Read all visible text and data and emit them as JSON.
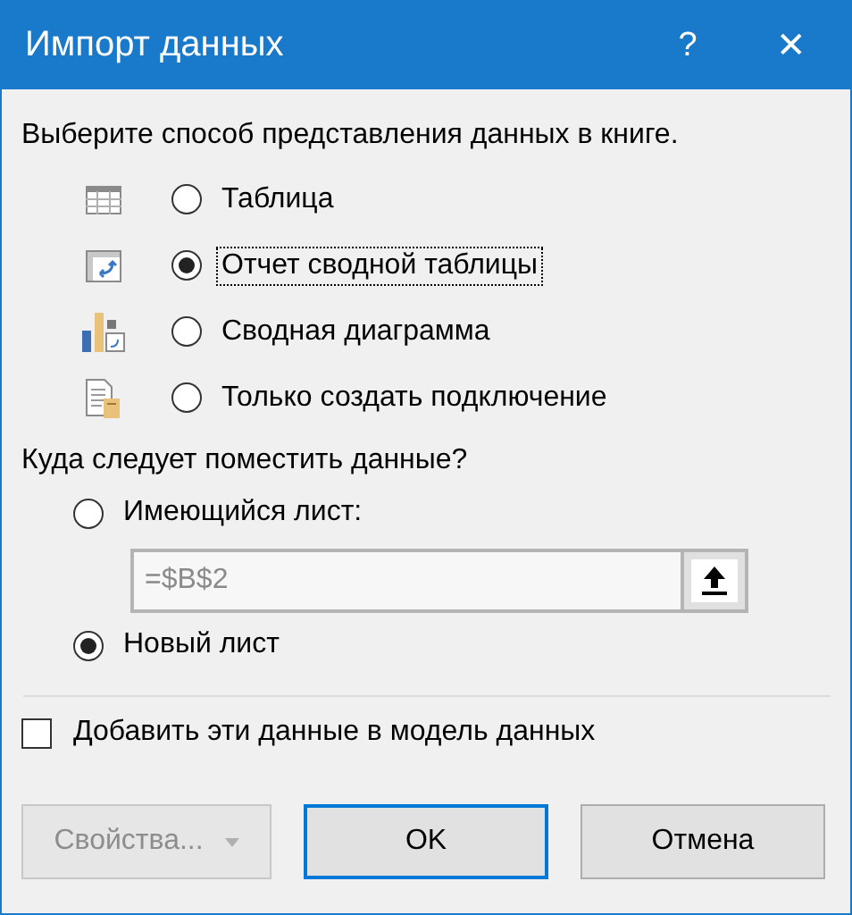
{
  "window": {
    "title": "Импорт данных",
    "help_button": "?",
    "close_button": "✕"
  },
  "view_prompt": "Выберите способ представления данных в книге.",
  "view_options": [
    {
      "kind": "table",
      "label": "Таблица",
      "selected": false,
      "focused": false
    },
    {
      "kind": "pivot",
      "label": "Отчет сводной таблицы",
      "selected": true,
      "focused": true
    },
    {
      "kind": "chart",
      "label": "Сводная диаграмма",
      "selected": false,
      "focused": false
    },
    {
      "kind": "connection",
      "label": "Только создать подключение",
      "selected": false,
      "focused": false
    }
  ],
  "place_prompt": "Куда следует поместить данные?",
  "existing_sheet": {
    "label": "Имеющийся лист:",
    "selected": false
  },
  "range_field": {
    "value": "=$B$2",
    "disabled": true
  },
  "new_sheet": {
    "label": "Новый лист",
    "selected": true
  },
  "data_model": {
    "label": "Добавить эти данные в модель данных",
    "checked": false
  },
  "buttons": [
    {
      "kind": "dropdown",
      "label": "Свойства...",
      "disabled": true,
      "default": false
    },
    {
      "kind": "plain",
      "label": "OK",
      "disabled": false,
      "default": true
    },
    {
      "kind": "plain",
      "label": "Отмена",
      "disabled": false,
      "default": false
    }
  ]
}
